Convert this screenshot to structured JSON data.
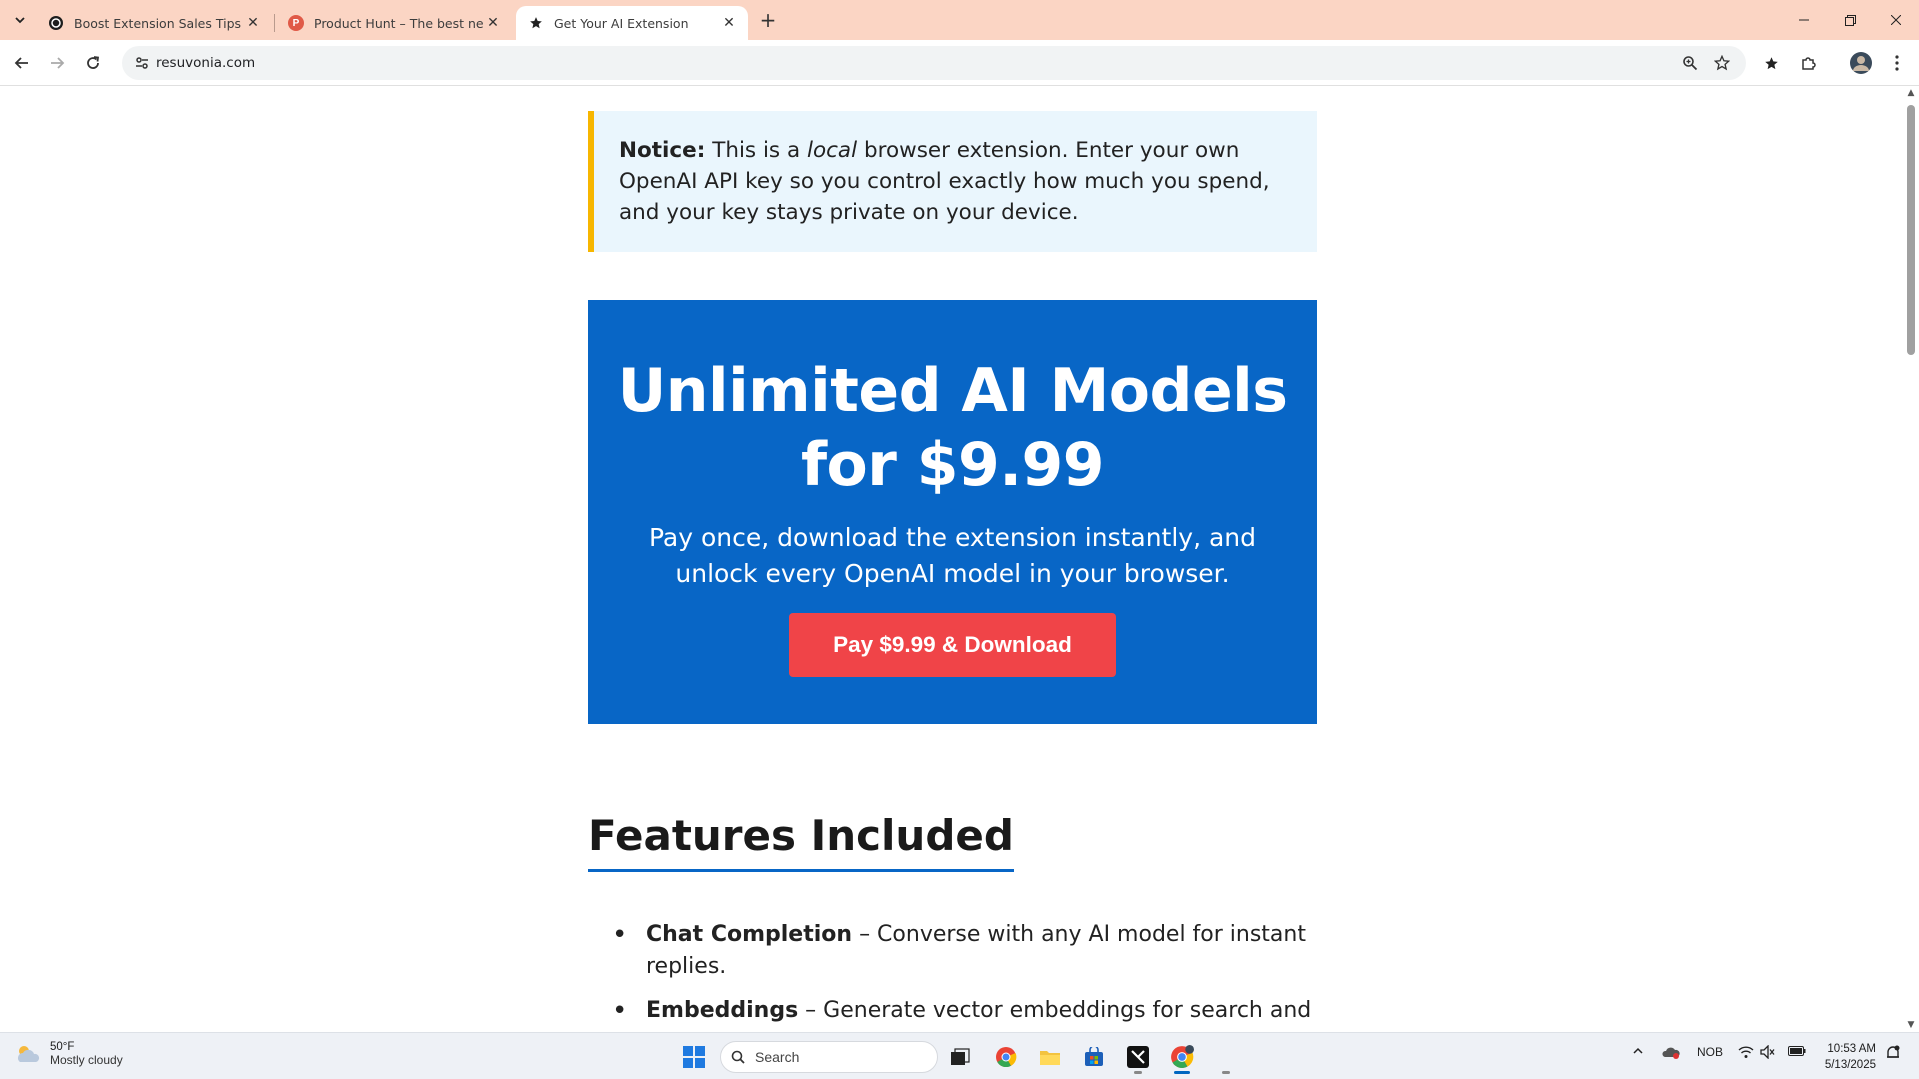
{
  "browser": {
    "tabs": [
      {
        "title": "Boost Extension Sales Tips",
        "icon": "openai-icon"
      },
      {
        "title": "Product Hunt – The best new products",
        "icon": "product-hunt-icon"
      },
      {
        "title": "Get Your AI Extension",
        "icon": "star-icon",
        "active": true
      }
    ],
    "url": "resuvonia.com"
  },
  "page": {
    "notice": {
      "label": "Notice:",
      "before_em": "This is a",
      "em": "local",
      "after_em": "browser extension. Enter your own OpenAI API key so you control exactly how much you spend, and your key stays private on your device."
    },
    "hero": {
      "title": "Unlimited AI Models for $9.99",
      "subtitle": "Pay once, download the extension instantly, and unlock every OpenAI model in your browser.",
      "cta": "Pay $9.99 & Download"
    },
    "features": {
      "title": "Features Included",
      "items": [
        {
          "name": "Chat Completion",
          "desc": "– Converse with any AI model for instant replies."
        },
        {
          "name": "Embeddings",
          "desc": "– Generate vector embeddings for search and"
        }
      ]
    }
  },
  "taskbar": {
    "weather": {
      "temp": "50°F",
      "condition": "Mostly cloudy"
    },
    "search_placeholder": "Search",
    "language": "NOB",
    "time": "10:53 AM",
    "date": "5/13/2025"
  },
  "colors": {
    "hero_bg": "#0866c6",
    "cta_bg": "#f04448",
    "notice_bg": "#eaf6fd",
    "notice_border": "#f7b600",
    "tabstrip_bg": "#fbd5c4"
  }
}
